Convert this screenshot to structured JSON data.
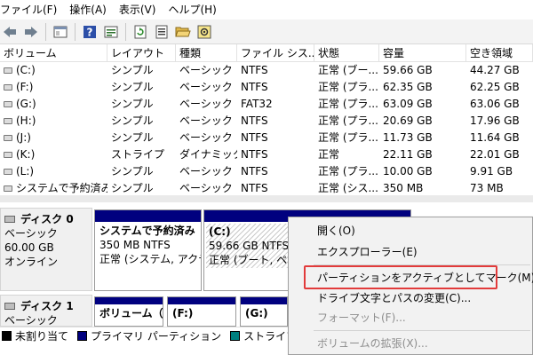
{
  "menu": [
    "ファイル(F)",
    "操作(A)",
    "表示(V)",
    "ヘルプ(H)"
  ],
  "toolbar": {
    "icons": [
      "back-arrow-icon",
      "forward-arrow-icon",
      "console-tree-icon",
      "help-icon",
      "properties-icon",
      "refresh-icon",
      "rescan-icon",
      "open-folder-icon",
      "settings-icon"
    ]
  },
  "volume_list": {
    "columns": [
      "ボリューム",
      "レイアウト",
      "種類",
      "ファイル シス...",
      "状態",
      "容量",
      "空き領域"
    ],
    "rows": [
      [
        "(C:)",
        "シンプル",
        "ベーシック",
        "NTFS",
        "正常 (ブー...",
        "59.66 GB",
        "44.27 GB"
      ],
      [
        "(F:)",
        "シンプル",
        "ベーシック",
        "NTFS",
        "正常 (プラ...",
        "62.35 GB",
        "62.25 GB"
      ],
      [
        "(G:)",
        "シンプル",
        "ベーシック",
        "FAT32",
        "正常 (プラ...",
        "63.09 GB",
        "63.06 GB"
      ],
      [
        "(H:)",
        "シンプル",
        "ベーシック",
        "NTFS",
        "正常 (プラ...",
        "20.69 GB",
        "17.96 GB"
      ],
      [
        "(J:)",
        "シンプル",
        "ベーシック",
        "NTFS",
        "正常 (プラ...",
        "11.73 GB",
        "11.64 GB"
      ],
      [
        "(K:)",
        "ストライプ",
        "ダイナミック",
        "NTFS",
        "正常",
        "22.11 GB",
        "22.01 GB"
      ],
      [
        "(L:)",
        "シンプル",
        "ベーシック",
        "NTFS",
        "正常 (プラ...",
        "10.00 GB",
        "9.91 GB"
      ],
      [
        "システムで予約済み",
        "シンプル",
        "ベーシック",
        "NTFS",
        "正常 (シス...",
        "350 MB",
        "73 MB"
      ]
    ]
  },
  "disks": [
    {
      "name": "ディスク 0",
      "type": "ベーシック",
      "size": "60.00 GB",
      "status": "オンライン"
    },
    {
      "name": "ディスク 1",
      "type": "ベーシック"
    }
  ],
  "disk0_partitions": [
    {
      "title": "システムで予約済み",
      "line1": "350 MB NTFS",
      "line2": "正常 (システム, アクテ"
    },
    {
      "title": "(C:)",
      "line1": "59.66 GB NTFS",
      "line2": "正常 (ブート, ペ"
    }
  ],
  "disk1_partitions": [
    "ボリューム（",
    "(F:)",
    "(G:)"
  ],
  "legend": [
    {
      "label": "未割り当て",
      "color": "#000000"
    },
    {
      "label": "プライマリ パーティション",
      "color": "#00007f"
    },
    {
      "label": "ストライプ ボリューム",
      "color": "#008080"
    }
  ],
  "context_menu": {
    "items": [
      {
        "label": "開く(O)",
        "disabled": false
      },
      {
        "label": "エクスプローラー(E)",
        "disabled": false
      },
      {
        "label": "パーティションをアクティブとしてマーク(M)",
        "disabled": false
      },
      {
        "label": "ドライブ文字とパスの変更(C)...",
        "disabled": false
      },
      {
        "label": "フォーマット(F)...",
        "disabled": true
      },
      {
        "label": "ボリュームの拡張(X)...",
        "disabled": true
      }
    ]
  }
}
